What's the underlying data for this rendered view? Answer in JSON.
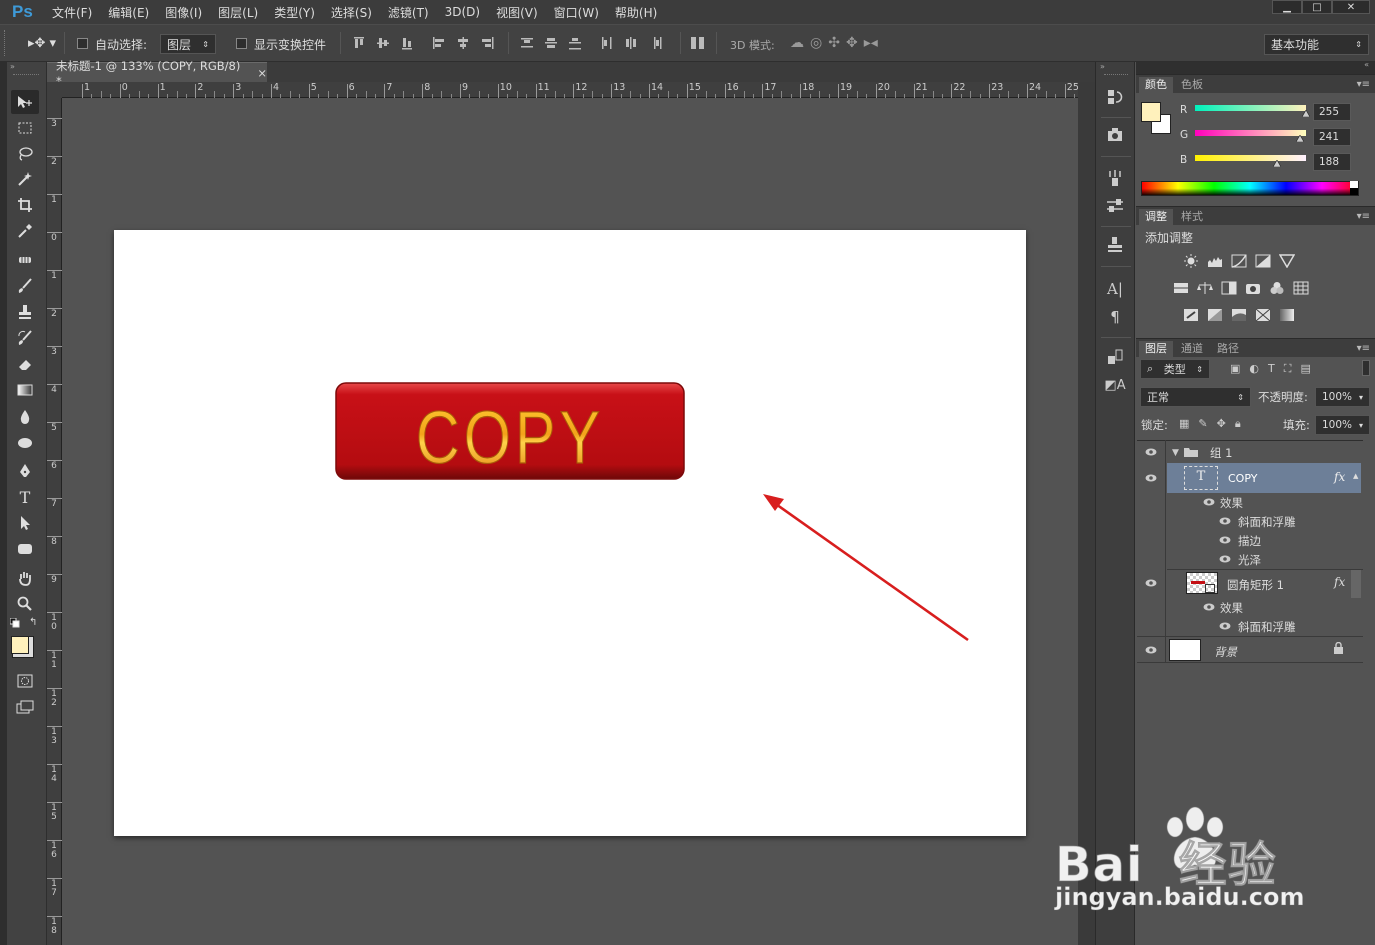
{
  "app": {
    "logo": "Ps"
  },
  "menu": [
    "文件(F)",
    "编辑(E)",
    "图像(I)",
    "图层(L)",
    "类型(Y)",
    "选择(S)",
    "滤镜(T)",
    "3D(D)",
    "视图(V)",
    "窗口(W)",
    "帮助(H)"
  ],
  "window_controls": [
    "minimize-icon",
    "maximize-icon",
    "close-icon"
  ],
  "options": {
    "auto_select_label": "自动选择:",
    "auto_select_value": "图层",
    "show_transform_label": "显示变换控件",
    "mode3d_label": "3D 模式:",
    "workspace": "基本功能"
  },
  "document": {
    "tab_title": "未标题-1 @ 133% (COPY, RGB/8) *",
    "close": "×",
    "button_text": "COPY",
    "button_color": "#c40f14",
    "arrow_color": "#d81e1e"
  },
  "rulers": {
    "h": [
      "1",
      "0",
      "1",
      "2",
      "3",
      "4",
      "5",
      "6",
      "7",
      "8",
      "9",
      "10",
      "11",
      "12",
      "13",
      "14",
      "15",
      "16",
      "17",
      "18",
      "19",
      "20",
      "21",
      "22",
      "23",
      "24",
      "25"
    ],
    "v": [
      "3",
      "2",
      "1",
      "0",
      "1",
      "2",
      "3",
      "4",
      "5",
      "6",
      "7",
      "8",
      "9",
      "10",
      "11",
      "12",
      "13",
      "14",
      "15",
      "16",
      "17",
      "18"
    ]
  },
  "color_panel": {
    "tabs": [
      "颜色",
      "色板"
    ],
    "foreground": "#fff1bc",
    "background": "#ffffff",
    "channels": [
      {
        "label": "R",
        "value": "255",
        "fraction": 1.0
      },
      {
        "label": "G",
        "value": "241",
        "fraction": 0.945
      },
      {
        "label": "B",
        "value": "188",
        "fraction": 0.737
      }
    ]
  },
  "adjust_panel": {
    "tabs": [
      "调整",
      "样式"
    ],
    "title": "添加调整"
  },
  "layers_panel": {
    "tabs": [
      "图层",
      "通道",
      "路径"
    ],
    "filter_kind": "类型",
    "blend_mode": "正常",
    "opacity_label": "不透明度:",
    "opacity": "100%",
    "lock_label": "锁定:",
    "fill_label": "填充:",
    "fill": "100%",
    "group": "组 1",
    "layers": [
      {
        "name": "COPY",
        "effects_label": "效果",
        "effects": [
          "斜面和浮雕",
          "描边",
          "光泽"
        ],
        "fx": "fx"
      },
      {
        "name": "圆角矩形 1",
        "effects_label": "效果",
        "effects": [
          "斜面和浮雕"
        ],
        "fx": "fx"
      },
      {
        "name": "背景"
      }
    ]
  },
  "watermark": {
    "brand": "Bai  经验",
    "url": "jingyan.baidu.com"
  }
}
